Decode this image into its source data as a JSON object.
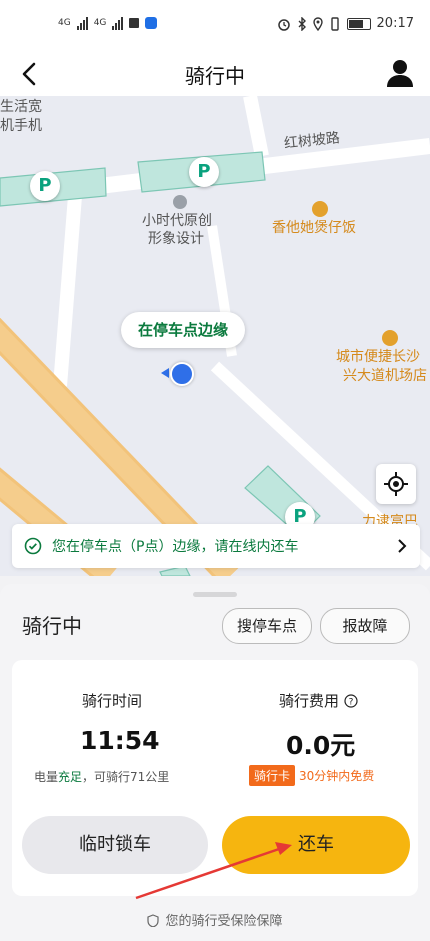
{
  "status_bar": {
    "network_1": "4G",
    "network_2": "4G",
    "time": "20:17"
  },
  "header": {
    "title": "骑行中"
  },
  "map": {
    "labels": {
      "fragment_1": "生活宽",
      "fragment_2": "机手机",
      "road": "红树坡路",
      "shop_line1": "小时代原创",
      "shop_line2": "形象设计",
      "restaurant": "香他她煲仔饭",
      "city_line1": "城市便捷长沙",
      "city_line2": "兴大道机场店",
      "bottom_fragment": "力逮富巴"
    },
    "parking_pin_label": "P",
    "bubble": "在停车点边缘"
  },
  "notice": {
    "text": "您在停车点（P点）边缘，请在线内还车"
  },
  "panel": {
    "title": "骑行中",
    "search_parking": "搜停车点",
    "report_fault": "报故障",
    "ride_time_label": "骑行时间",
    "ride_time": "11:54",
    "battery_prefix": "电量",
    "battery_status": "充足",
    "battery_suffix": "，可骑行71公里",
    "fee_label": "骑行费用",
    "fee": "0.0元",
    "card_badge": "骑行卡",
    "free_text": "30分钟内免费",
    "lock_button": "临时锁车",
    "return_button": "还车",
    "insurance": "您的骑行受保险保障"
  },
  "colors": {
    "accent_yellow": "#f6b50f",
    "green": "#0b7a3e",
    "badge_orange": "#f26a1b",
    "location_blue": "#2f6fe8"
  }
}
